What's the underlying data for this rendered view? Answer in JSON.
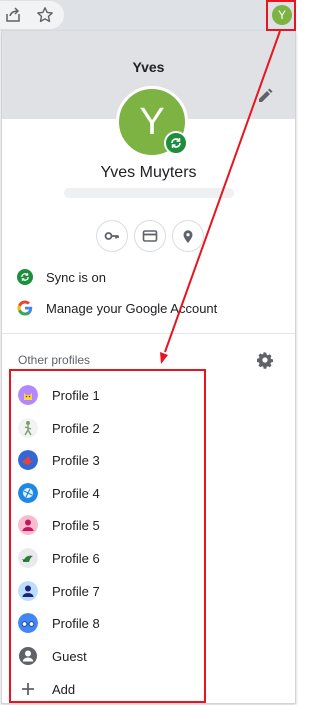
{
  "toolbar": {
    "icons": [
      "share-icon",
      "star-icon"
    ],
    "avatar_letter": "Y"
  },
  "profile": {
    "short_name": "Yves",
    "avatar_letter": "Y",
    "full_name": "Yves Muyters",
    "avatar_color": "#7cb342",
    "header_color": "#dfe1e5"
  },
  "quick_actions": [
    "key-icon",
    "card-icon",
    "location-icon"
  ],
  "menu": {
    "sync_label": "Sync is on",
    "manage_label": "Manage your Google Account"
  },
  "other_profiles": {
    "title": "Other profiles",
    "items": [
      {
        "label": "Profile 1",
        "icon": "cat-avatar-icon",
        "color": "#b388ff"
      },
      {
        "label": "Profile 2",
        "icon": "figure-avatar-icon",
        "color": "#e8eaed"
      },
      {
        "label": "Profile 3",
        "icon": "origami-bird-avatar-icon",
        "color": "#3367d6"
      },
      {
        "label": "Profile 4",
        "icon": "ball-avatar-icon",
        "color": "#1e88e5"
      },
      {
        "label": "Profile 5",
        "icon": "person-avatar-icon",
        "color": "#f8bbd0"
      },
      {
        "label": "Profile 6",
        "icon": "plant-avatar-icon",
        "color": "#e8eaed"
      },
      {
        "label": "Profile 7",
        "icon": "person-avatar-icon",
        "color": "#1a73e8"
      },
      {
        "label": "Profile 8",
        "icon": "glasses-avatar-icon",
        "color": "#4285f4"
      },
      {
        "label": "Guest",
        "icon": "guest-icon",
        "color": "#5f6368"
      },
      {
        "label": "Add",
        "icon": "add-icon",
        "color": "#5f6368"
      }
    ]
  },
  "annotation_color": "#e8141e"
}
